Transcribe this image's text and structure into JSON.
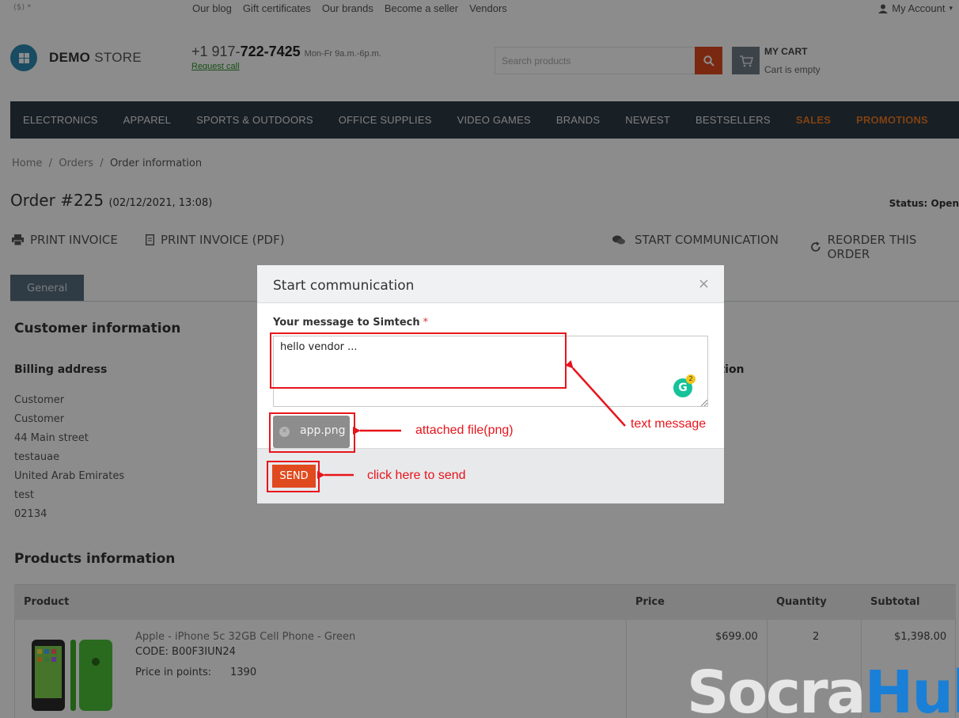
{
  "topbar": {
    "currency": "($) *",
    "links": [
      "Our blog",
      "Gift certificates",
      "Our brands",
      "Become a seller",
      "Vendors"
    ],
    "account": "My Account"
  },
  "header": {
    "logo_bold": "DEMO",
    "logo_light": "STORE",
    "phone_prefix": "+1 917-",
    "phone_main": "722-7425",
    "phone_hours": "Mon-Fr 9a.m.-6p.m.",
    "request_call": "Request call",
    "search_placeholder": "Search products",
    "cart_title": "MY CART",
    "cart_status": "Cart is empty"
  },
  "nav": {
    "items": [
      "ELECTRONICS",
      "APPAREL",
      "SPORTS & OUTDOORS",
      "OFFICE SUPPLIES",
      "VIDEO GAMES",
      "BRANDS",
      "NEWEST",
      "BESTSELLERS"
    ],
    "hot_items": [
      "SALES",
      "PROMOTIONS"
    ]
  },
  "breadcrumb": {
    "home": "Home",
    "orders": "Orders",
    "current": "Order information",
    "sep": "/"
  },
  "order": {
    "title": "Order #225",
    "date": "(02/12/2021, 13:08)",
    "status": "Status: Open"
  },
  "actions": {
    "print_invoice": "PRINT INVOICE",
    "print_invoice_pdf": "PRINT INVOICE (PDF)",
    "start_communication": "START COMMUNICATION",
    "reorder": "REORDER THIS ORDER"
  },
  "tabs": {
    "general": "General"
  },
  "customer": {
    "heading": "Customer information",
    "billing_heading": "Billing address",
    "right_heading_fragment": "ation",
    "billing_lines": [
      "Customer",
      "Customer",
      "44 Main street",
      "testauae",
      "United Arab Emirates",
      "test",
      "02134"
    ]
  },
  "products": {
    "heading": "Products information",
    "columns": {
      "product": "Product",
      "price": "Price",
      "quantity": "Quantity",
      "subtotal": "Subtotal"
    },
    "rows": [
      {
        "name": "Apple - iPhone 5c 32GB Cell Phone - Green",
        "code": "CODE: B00F3IUN24",
        "points_label": "Price in points:",
        "points_value": "1390",
        "price": "$699.00",
        "quantity": "2",
        "subtotal": "$1,398.00"
      }
    ]
  },
  "modal": {
    "title": "Start communication",
    "close": "×",
    "message_label": "Your message to Simtech",
    "required_mark": "*",
    "message_value": "hello vendor ...",
    "grammarly_letter": "G",
    "grammarly_count": "2",
    "attachment": "app.png",
    "send": "SEND"
  },
  "annotations": {
    "text_message": "text message",
    "attached_file": "attached file(png)",
    "click_send": "click here to send",
    "color": "#e8141c"
  },
  "watermark": {
    "part1": "Socra",
    "part2": "Hub"
  },
  "colors": {
    "accent": "#e04a1f",
    "nav_bg": "#2d3a44",
    "hot": "#e87722"
  }
}
